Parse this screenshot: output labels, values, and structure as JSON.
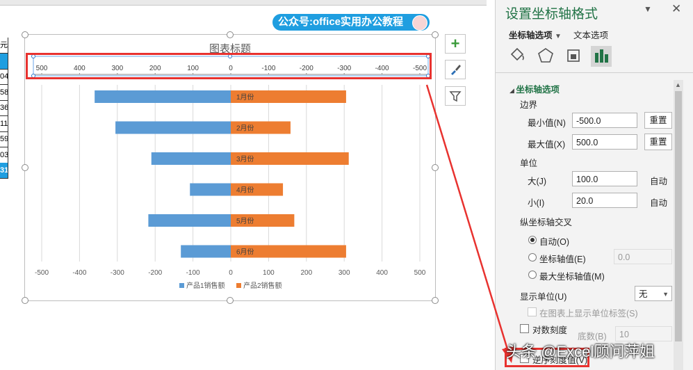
{
  "sheet": {
    "row_values": [
      "元",
      "",
      "04",
      "58",
      "36",
      "11",
      "59",
      "03",
      "31"
    ]
  },
  "badge": {
    "text": "公众号:office实用办公教程"
  },
  "chart_data": {
    "type": "bar",
    "orientation": "horizontal",
    "title": "图表标题",
    "categories": [
      "1月份",
      "2月份",
      "3月份",
      "4月份",
      "5月份",
      "6月份"
    ],
    "series": [
      {
        "name": "产品1销售额",
        "color": "#5b9bd5",
        "values": [
          360,
          305,
          210,
          108,
          218,
          132
        ]
      },
      {
        "name": "产品2销售额",
        "color": "#ed7d31",
        "values": [
          305,
          158,
          312,
          138,
          168,
          305
        ]
      }
    ],
    "xlim": [
      -500,
      500
    ],
    "top_axis_ticks": [
      "500",
      "400",
      "300",
      "200",
      "100",
      "0",
      "-100",
      "-200",
      "-300",
      "-400",
      "-500"
    ],
    "bottom_axis_ticks": [
      "-500",
      "-400",
      "-300",
      "-200",
      "-100",
      "0",
      "100",
      "200",
      "300",
      "400",
      "500"
    ],
    "grid": true,
    "legend_position": "bottom"
  },
  "pane": {
    "title": "设置坐标轴格式",
    "tab_axis_options": "坐标轴选项",
    "tab_text_options": "文本选项",
    "section_axis_options": "坐标轴选项",
    "bounds_label": "边界",
    "min_label": "最小值(N)",
    "min_value": "-500.0",
    "max_label": "最大值(X)",
    "max_value": "500.0",
    "reset_label": "重置",
    "units_label": "单位",
    "major_label": "大(J)",
    "major_value": "100.0",
    "minor_label": "小(I)",
    "minor_value": "20.0",
    "auto_label": "自动",
    "cross_label": "纵坐标轴交叉",
    "radio_auto": "自动(O)",
    "radio_axis_value": "坐标轴值(E)",
    "axis_value": "0.0",
    "radio_max": "最大坐标轴值(M)",
    "display_units_label": "显示单位(U)",
    "display_units_value": "无",
    "show_units_label": "在图表上显示单位标签(S)",
    "log_scale_label": "对数刻度",
    "base_label": "底数(B)",
    "base_value": "10",
    "reverse_label": "逆序刻度值(V)"
  },
  "watermark": {
    "text": "头条 @Excel顾问萍姐"
  },
  "colors": {
    "highlight_red": "#e8322f",
    "accent_blue": "#1f9ee0",
    "pane_green": "#217346"
  }
}
